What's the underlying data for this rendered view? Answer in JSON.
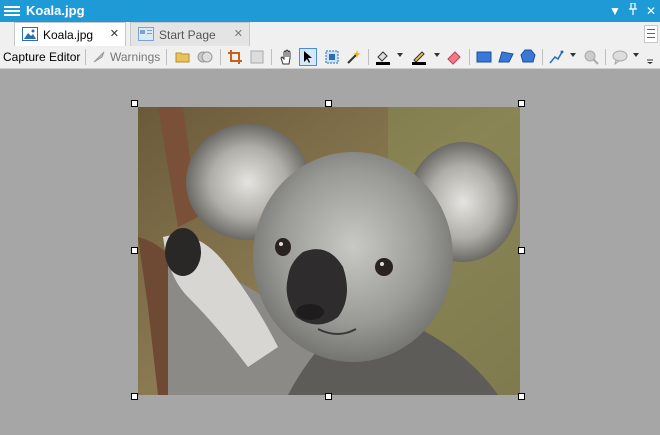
{
  "window": {
    "title": "Koala.jpg"
  },
  "tabs": [
    {
      "label": "Koala.jpg",
      "active": true,
      "icon": "image-icon"
    },
    {
      "label": "Start Page",
      "active": false,
      "icon": "start-page-icon"
    }
  ],
  "toolbar": {
    "capture_editor_label": "Capture Editor",
    "warnings_label": "Warnings",
    "tools": [
      "open-folder-icon",
      "copy-icon",
      "crop-icon",
      "resize-icon",
      "hand-icon",
      "pointer-icon",
      "select-region-icon",
      "magic-wand-icon",
      "fill-icon",
      "pen-icon",
      "eraser-icon",
      "rectangle-icon",
      "polygon-icon",
      "ellipse-icon",
      "line-icon",
      "magnifier-icon",
      "speech-bubble-icon"
    ]
  },
  "canvas": {
    "image_name": "koala photo"
  },
  "colors": {
    "titlebar": "#1e9ad6",
    "canvas_bg": "#a6a6a6"
  }
}
